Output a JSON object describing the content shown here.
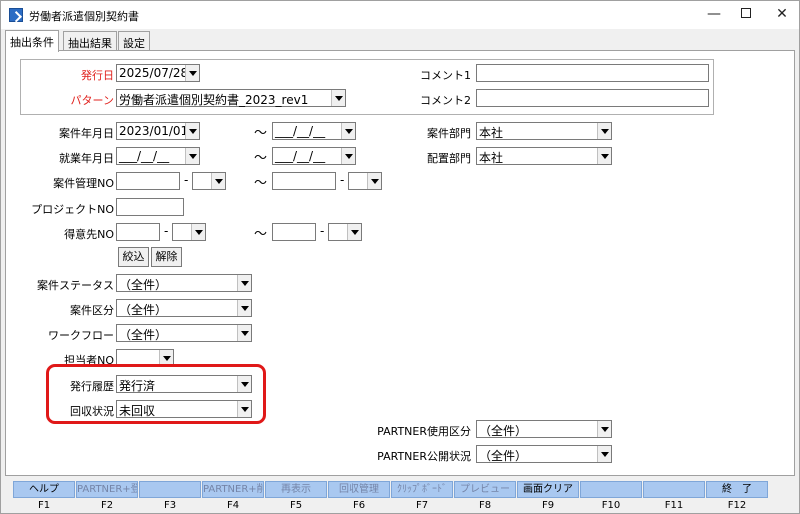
{
  "window": {
    "title": "労働者派遣個別契約書",
    "minimize_glyph": "—",
    "close_glyph": "✕"
  },
  "tabs": [
    {
      "label": "抽出条件",
      "active": true
    },
    {
      "label": "抽出結果",
      "active": false
    },
    {
      "label": "設定",
      "active": false
    }
  ],
  "header": {
    "issue_date_label": "発行日",
    "issue_date_value": "2025/07/28",
    "pattern_label": "パターン",
    "pattern_value": "労働者派遣個別契約書_2023_rev1",
    "comment1_label": "コメント1",
    "comment1_value": "",
    "comment2_label": "コメント2",
    "comment2_value": ""
  },
  "form": {
    "case_date_label": "案件年月日",
    "case_date_from": "2023/01/01",
    "case_date_to": "___/__/__",
    "work_date_label": "就業年月日",
    "work_date_from": "___/__/__",
    "work_date_to": "___/__/__",
    "case_mgmt_label": "案件管理NO",
    "project_label": "プロジェクトNO",
    "customer_label": "得意先NO",
    "case_dept_label": "案件部門",
    "case_dept_value": "本社",
    "assign_dept_label": "配置部門",
    "assign_dept_value": "本社",
    "tilde": "～",
    "dash": "-",
    "narrow_button": "絞込",
    "clear_button": "解除",
    "case_status_label": "案件ステータス",
    "case_status_value": "（全件）",
    "case_class_label": "案件区分",
    "case_class_value": "（全件）",
    "workflow_label": "ワークフロー",
    "workflow_value": "（全件）",
    "staff_label": "担当者NO",
    "issue_history_label": "発行履歴",
    "issue_history_value": "発行済",
    "collection_label": "回収状況",
    "collection_value": "未回収",
    "partner_use_label": "PARTNER使用区分",
    "partner_use_value": "（全件）",
    "partner_public_label": "PARTNER公開状況",
    "partner_public_value": "（全件）"
  },
  "fkeys": [
    {
      "label": "ヘルプ",
      "key": "F1",
      "enabled": true
    },
    {
      "label": "PARTNER+登録",
      "key": "F2",
      "enabled": false
    },
    {
      "label": "",
      "key": "F3",
      "enabled": true
    },
    {
      "label": "PARTNER+削除",
      "key": "F4",
      "enabled": false
    },
    {
      "label": "再表示",
      "key": "F5",
      "enabled": false
    },
    {
      "label": "回収管理",
      "key": "F6",
      "enabled": false
    },
    {
      "label": "ｸﾘｯﾌﾟﾎﾞｰﾄﾞ",
      "key": "F7",
      "enabled": false
    },
    {
      "label": "プレビュー",
      "key": "F8",
      "enabled": false
    },
    {
      "label": "画面クリア",
      "key": "F9",
      "enabled": true
    },
    {
      "label": "",
      "key": "F10",
      "enabled": true
    },
    {
      "label": "",
      "key": "F11",
      "enabled": true
    },
    {
      "label": "終　了",
      "key": "F12",
      "enabled": true
    }
  ],
  "colors": {
    "required_label": "#e0201c",
    "fkey_bg": "#a9c8f0",
    "highlight_border": "#e01818"
  }
}
